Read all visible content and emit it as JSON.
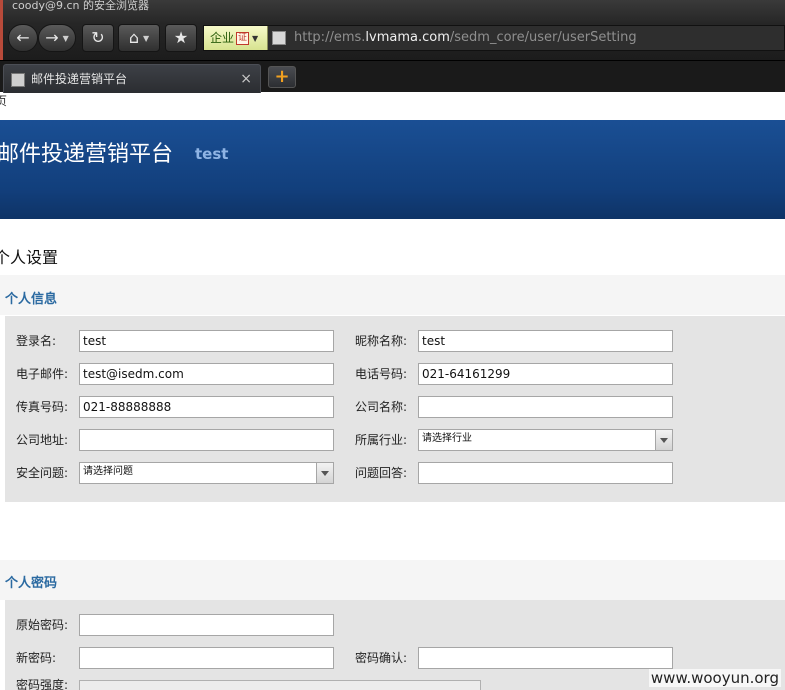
{
  "browser": {
    "window_title": "coody@9.cn 的安全浏览器",
    "nav_icons": [
      "back-arrow-icon",
      "forward-arrow-icon",
      "refresh-icon",
      "home-icon",
      "star-icon"
    ],
    "badge_label": "企业",
    "badge_cert": "证",
    "url_prefix": "http://ems.",
    "url_host": "lvmama.com",
    "url_path": "/sedm_core/user/userSetting",
    "tab_title": "邮件投递营销平台",
    "tab_close": "×",
    "new_tab": "+"
  },
  "page": {
    "breadcrumb": "页",
    "banner_title": "邮件投递营销平台",
    "banner_sub": "test",
    "heading": "个人设置",
    "watermark": "www.wooyun.org"
  },
  "personal_info": {
    "title": "个人信息",
    "login_label": "登录名:",
    "login_value": "test",
    "nickname_label": "昵称名称:",
    "nickname_value": "test",
    "email_label": "电子邮件:",
    "email_value": "test@isedm.com",
    "phone_label": "电话号码:",
    "phone_value": "021-64161299",
    "fax_label": "传真号码:",
    "fax_value": "021-88888888",
    "company_label": "公司名称:",
    "company_value": "",
    "address_label": "公司地址:",
    "address_value": "",
    "industry_label": "所属行业:",
    "industry_value": "请选择行业",
    "question_label": "安全问题:",
    "question_value": "请选择问题",
    "answer_label": "问题回答:",
    "answer_value": ""
  },
  "password": {
    "title": "个人密码",
    "old_label": "原始密码:",
    "new_label": "新密码:",
    "confirm_label": "密码确认:",
    "strength_label": "密码强度:"
  }
}
